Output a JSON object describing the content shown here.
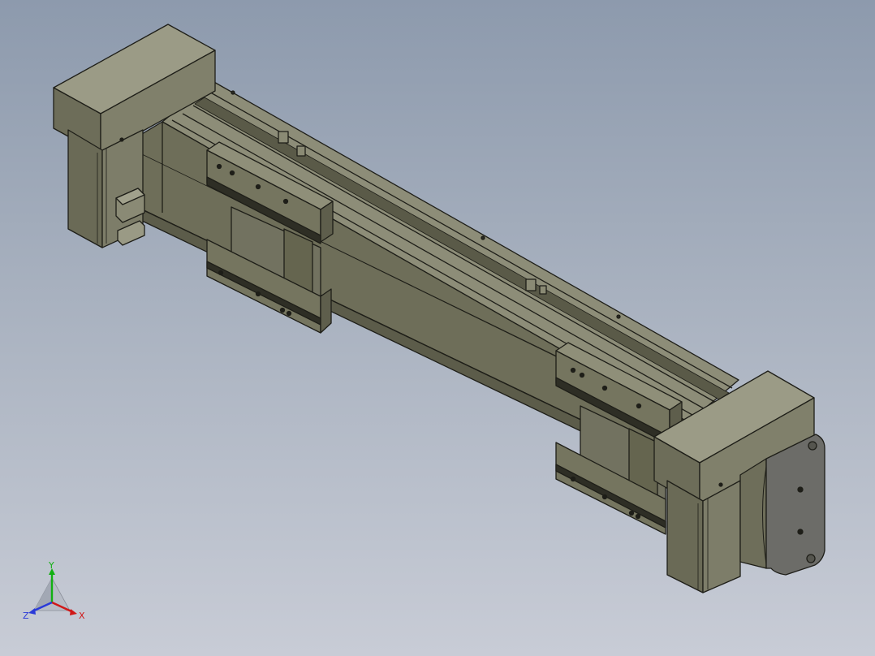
{
  "viewport": {
    "background_top": "#8d9aad",
    "background_bottom": "#c8ccd6"
  },
  "model": {
    "body_color": "#7b7b66",
    "edge_color": "#1e1e18"
  },
  "triad": {
    "x_label": "X",
    "y_label": "Y",
    "z_label": "Z",
    "x_color": "#d01818",
    "y_color": "#12b012",
    "z_color": "#2a3ad8"
  }
}
